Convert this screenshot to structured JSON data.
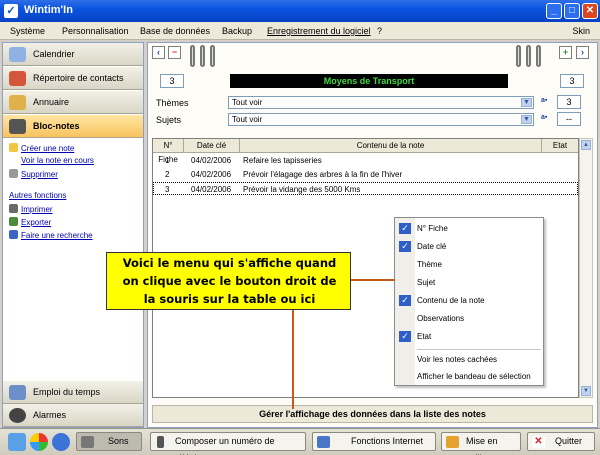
{
  "window": {
    "title": "Wintim'In",
    "minimize": "_",
    "maximize": "□",
    "close": "✕"
  },
  "menu": [
    "Système",
    "Personnalisation",
    "Base de données",
    "Backup",
    "Enregistrement du logiciel",
    "?"
  ],
  "menu_skin": "Skin",
  "sidebar": {
    "tabs_top": [
      "Calendrier",
      "Répertoire de contacts",
      "Annuaire",
      "Bloc-notes"
    ],
    "links": [
      "Créer une note",
      "Voir la note en cours",
      "Supprimer"
    ],
    "other_title": "Autres fonctions",
    "other_links": [
      "Imprimer",
      "Exporter",
      "Faire une recherche"
    ],
    "tabs_bottom": [
      "Emploi du temps",
      "Alarmes"
    ]
  },
  "notebook": {
    "left_number": "3",
    "title": "Moyens de Transport",
    "right_number": "3",
    "themes_label": "Thèmes",
    "themes_value": "Tout voir",
    "themes_count": "3",
    "subjects_label": "Sujets",
    "subjects_value": "Tout voir",
    "subjects_count": "--",
    "columns": [
      "N° Fiche",
      "Date clé",
      "Contenu de la note",
      "Etat"
    ],
    "rows": [
      {
        "id": "1",
        "date": "04/02/2006",
        "content": "Refaire les tapisseries"
      },
      {
        "id": "2",
        "date": "04/02/2006",
        "content": "Prévoir l'élagage des arbres à la fin de l'hiver"
      },
      {
        "id": "3",
        "date": "04/02/2006",
        "content": "Prévoir la vidange des 5000 Kms"
      }
    ],
    "footer": "Gérer l'affichage des données dans la liste des notes"
  },
  "context_menu": [
    {
      "label": "N° Fiche",
      "checked": true
    },
    {
      "label": "Date clé",
      "checked": true
    },
    {
      "label": "Thème",
      "checked": false
    },
    {
      "label": "Sujet",
      "checked": false
    },
    {
      "label": "Contenu de la note",
      "checked": true
    },
    {
      "label": "Observations",
      "checked": false
    },
    {
      "label": "Etat",
      "checked": true
    },
    {
      "label": "Voir les notes cachées",
      "checked": false
    },
    {
      "label": "Afficher le bandeau de sélection",
      "checked": false
    }
  ],
  "annotation": [
    "Voici le menu qui s'affiche quand",
    "on clique avec le bouton droit de",
    "la souris sur la table ou ici"
  ],
  "bottombar": {
    "sons": "Sons",
    "phone": "Composer un numéro de téléphone",
    "internet": "Fonctions Internet",
    "standby": "Mise en veille",
    "quit": "Quitter"
  },
  "colors": {
    "titlebar": "#0a54e0",
    "banner_text": "#3fdc3f",
    "callout": "#ffff00",
    "check": "#2f5ec7",
    "link": "#0000b0"
  }
}
